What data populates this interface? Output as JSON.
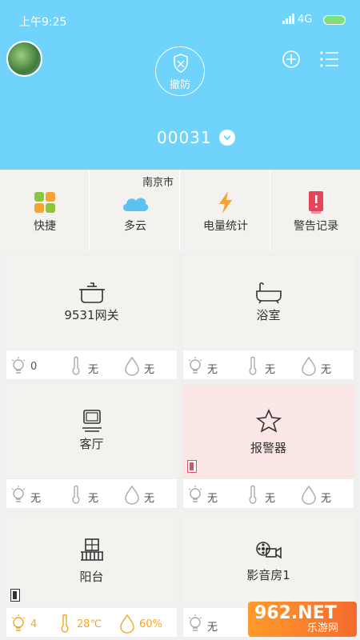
{
  "status": {
    "time": "上午9:25",
    "network": "4G"
  },
  "header": {
    "arm_label": "撤防",
    "device_id": "00031"
  },
  "quick": {
    "city": "南京市",
    "items": [
      {
        "label": "快捷"
      },
      {
        "label": "多云"
      },
      {
        "label": "电量统计"
      },
      {
        "label": "警告记录"
      }
    ]
  },
  "rooms": [
    {
      "name": "9531网关",
      "light": "0",
      "temp": "无",
      "humidity": "无"
    },
    {
      "name": "浴室",
      "light": "无",
      "temp": "无",
      "humidity": "无"
    },
    {
      "name": "客厅",
      "light": "无",
      "temp": "无",
      "humidity": "无"
    },
    {
      "name": "报警器",
      "light": "无",
      "temp": "无",
      "humidity": "无"
    },
    {
      "name": "阳台",
      "light": "4",
      "temp": "28℃",
      "humidity": "60%"
    },
    {
      "name": "影音房1",
      "light": "无",
      "temp": "",
      "humidity": ""
    }
  ],
  "watermark": {
    "brand": "962.NET",
    "sub": "乐游网"
  },
  "colors": {
    "header": "#6fd3fb",
    "alarm_card": "#fae7e6",
    "active_stat": "#f5a623"
  }
}
